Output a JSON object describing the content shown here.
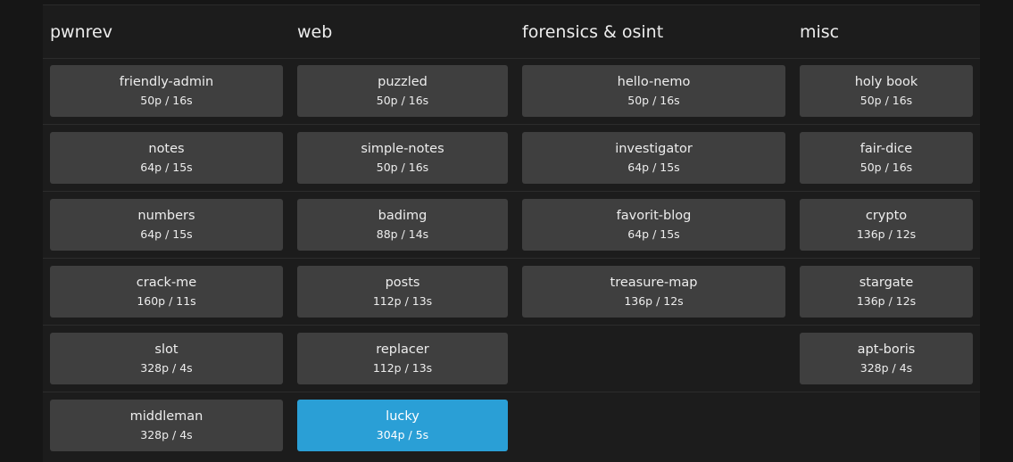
{
  "categories": [
    {
      "title": "pwnrev",
      "challenges": [
        {
          "name": "friendly-admin",
          "meta": "50p / 16s"
        },
        {
          "name": "notes",
          "meta": "64p / 15s"
        },
        {
          "name": "numbers",
          "meta": "64p / 15s"
        },
        {
          "name": "crack-me",
          "meta": "160p / 11s"
        },
        {
          "name": "slot",
          "meta": "328p / 4s"
        },
        {
          "name": "middleman",
          "meta": "328p / 4s"
        }
      ]
    },
    {
      "title": "web",
      "challenges": [
        {
          "name": "puzzled",
          "meta": "50p / 16s"
        },
        {
          "name": "simple-notes",
          "meta": "50p / 16s"
        },
        {
          "name": "badimg",
          "meta": "88p / 14s"
        },
        {
          "name": "posts",
          "meta": "112p / 13s"
        },
        {
          "name": "replacer",
          "meta": "112p / 13s"
        },
        {
          "name": "lucky",
          "meta": "304p / 5s",
          "solved": true
        }
      ]
    },
    {
      "title": "forensics & osint",
      "challenges": [
        {
          "name": "hello-nemo",
          "meta": "50p / 16s"
        },
        {
          "name": "investigator",
          "meta": "64p / 15s"
        },
        {
          "name": "favorit-blog",
          "meta": "64p / 15s"
        },
        {
          "name": "treasure-map",
          "meta": "136p / 12s"
        }
      ]
    },
    {
      "title": "misc",
      "challenges": [
        {
          "name": "holy book",
          "meta": "50p / 16s"
        },
        {
          "name": "fair-dice",
          "meta": "50p / 16s"
        },
        {
          "name": "crypto",
          "meta": "136p / 12s"
        },
        {
          "name": "stargate",
          "meta": "136p / 12s"
        },
        {
          "name": "apt-boris",
          "meta": "328p / 4s"
        }
      ]
    }
  ],
  "colors": {
    "card": "#3f3f3f",
    "solved": "#2a9fd6",
    "background": "#1c1c1c"
  }
}
